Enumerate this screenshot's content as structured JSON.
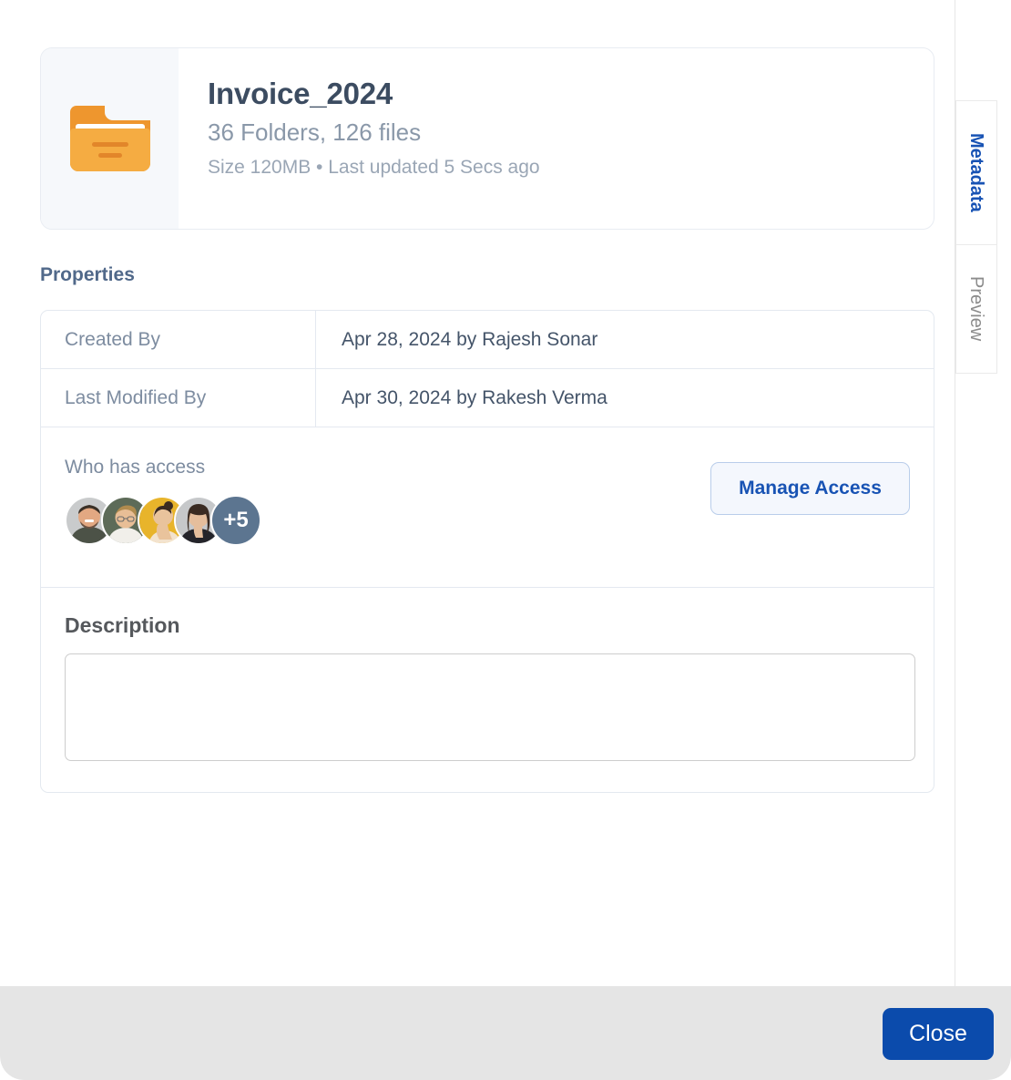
{
  "file": {
    "icon": "folder-icon",
    "title": "Invoice_2024",
    "counts": "36 Folders, 126 files",
    "meta": "Size 120MB • Last updated 5 Secs ago"
  },
  "properties": {
    "heading": "Properties",
    "rows": [
      {
        "label": "Created By",
        "value": "Apr 28, 2024 by Rajesh Sonar"
      },
      {
        "label": "Last Modified By",
        "value": "Apr 30, 2024 by Rakesh Verma"
      }
    ]
  },
  "access": {
    "label": "Who has access",
    "avatars": [
      {
        "name": "avatar-person-1",
        "bg": "#C9CBCC",
        "skin": "#E2A882",
        "hair": "#3A3026",
        "shirt": "#4C5247"
      },
      {
        "name": "avatar-person-2",
        "bg": "#5D6B58",
        "skin": "#E8BE96",
        "hair": "#B08B4E",
        "shirt": "#F1EFEA"
      },
      {
        "name": "avatar-person-3",
        "bg": "#E8B42B",
        "skin": "#E9C39C",
        "hair": "#3B2B20",
        "shirt": "#F3E3CE"
      },
      {
        "name": "avatar-person-4",
        "bg": "#C6C8CA",
        "skin": "#E5BE9C",
        "hair": "#3A2B22",
        "shirt": "#24242A"
      }
    ],
    "more_count": "+5",
    "manage_button": "Manage Access"
  },
  "description": {
    "label": "Description",
    "value": "",
    "placeholder": ""
  },
  "tabs": [
    {
      "label": "Metadata",
      "active": true
    },
    {
      "label": "Preview",
      "active": false
    }
  ],
  "footer": {
    "close_label": "Close"
  },
  "colors": {
    "accent_blue": "#1853B4",
    "primary_button": "#0B4BAC",
    "folder_orange": "#F5AC42",
    "folder_orange_dark": "#EE962E",
    "avatar_more_bg": "#5C7590",
    "title_text": "#3C4C61",
    "muted_text": "#8A98A9",
    "footer_bg": "#E5E5E5"
  }
}
